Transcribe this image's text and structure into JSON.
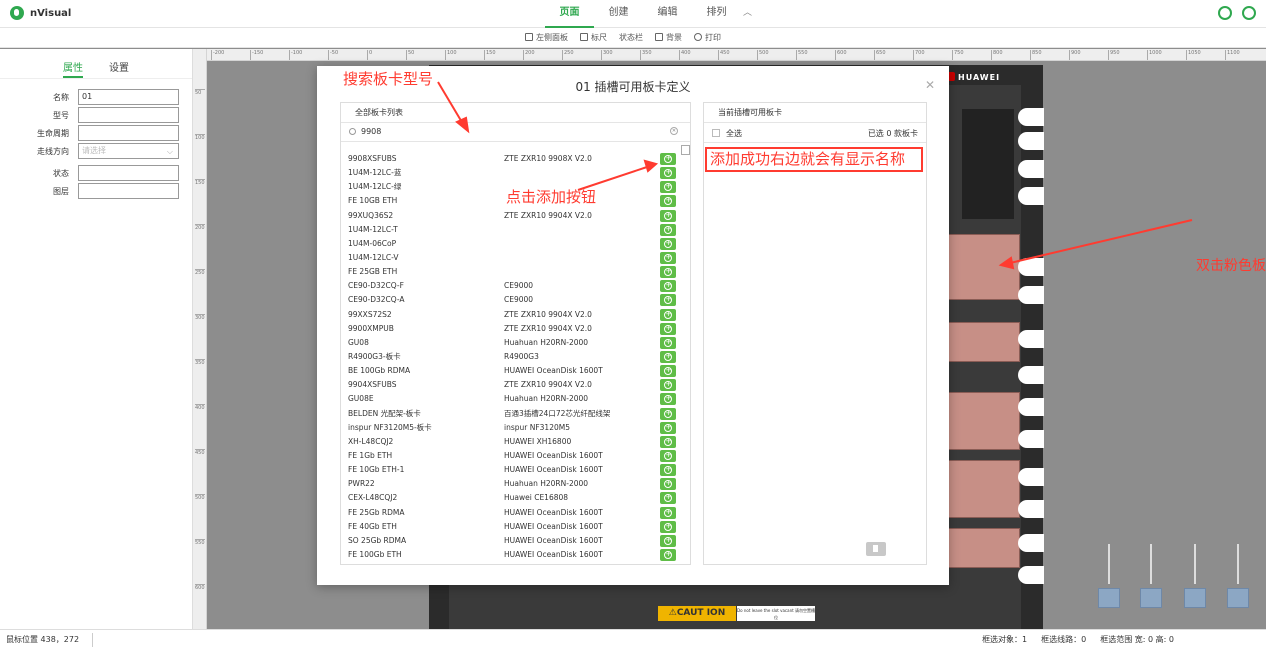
{
  "app": {
    "name": "nVisual"
  },
  "menu_tabs": [
    {
      "label": "页面",
      "active": true
    },
    {
      "label": "创建",
      "active": false
    },
    {
      "label": "编辑",
      "active": false
    },
    {
      "label": "排列",
      "active": false
    }
  ],
  "toolbar": {
    "items": [
      "左侧面板",
      "标尺",
      "状态栏",
      "背景",
      "打印"
    ]
  },
  "left_panel": {
    "tabs": [
      {
        "label": "属性",
        "active": true
      },
      {
        "label": "设置",
        "active": false
      }
    ],
    "fields": [
      {
        "label": "名称",
        "value": "01"
      },
      {
        "label": "型号",
        "value": ""
      },
      {
        "label": "生命周期",
        "value": ""
      },
      {
        "label": "走线方向",
        "value": "",
        "placeholder": "请选择"
      },
      {
        "label": "状态",
        "value": ""
      },
      {
        "label": "图层",
        "value": ""
      }
    ]
  },
  "ruler": {
    "top_ticks": [
      "-200",
      "-150",
      "-100",
      "-50",
      "0",
      "50",
      "100",
      "150",
      "200",
      "250",
      "300",
      "350",
      "400",
      "450",
      "500",
      "550",
      "600",
      "650",
      "700",
      "750",
      "800",
      "850",
      "900",
      "950",
      "1000",
      "1050",
      "1100"
    ],
    "left_ticks": [
      "50",
      "100",
      "150",
      "200",
      "250",
      "300",
      "350",
      "400",
      "450",
      "500",
      "550",
      "600"
    ]
  },
  "rack": {
    "brand": "HUAWEI",
    "caution": "⚠CAUT ION",
    "caution_note": "Do not leave the slot vacant 请勿空置槽位"
  },
  "modal": {
    "title": "01 插槽可用板卡定义",
    "left_header": "全部板卡列表",
    "search_value": "9908",
    "right_header": "当前插槽可用板卡",
    "select_all": "全选",
    "selected_count": "已选 0 款板卡",
    "cards": [
      {
        "model": "9908XSFUBS",
        "device": "ZTE ZXR10 9908X V2.0"
      },
      {
        "model": "1U4M-12LC-蓝",
        "device": ""
      },
      {
        "model": "1U4M-12LC-绿",
        "device": ""
      },
      {
        "model": "FE 10GB ETH",
        "device": ""
      },
      {
        "model": "99XUQ36S2",
        "device": "ZTE ZXR10 9904X V2.0"
      },
      {
        "model": "1U4M-12LC-T",
        "device": ""
      },
      {
        "model": "1U4M-06CoP",
        "device": ""
      },
      {
        "model": "1U4M-12LC-V",
        "device": ""
      },
      {
        "model": "FE 25GB ETH",
        "device": ""
      },
      {
        "model": "CE90-D32CQ-F",
        "device": "CE9000"
      },
      {
        "model": "CE90-D32CQ-A",
        "device": "CE9000"
      },
      {
        "model": "99XXS72S2",
        "device": "ZTE ZXR10 9904X V2.0"
      },
      {
        "model": "9900XMPUB",
        "device": "ZTE ZXR10 9904X V2.0"
      },
      {
        "model": "GU08",
        "device": "Huahuan H20RN-2000"
      },
      {
        "model": "R4900G3-板卡",
        "device": "R4900G3"
      },
      {
        "model": "BE 100Gb RDMA",
        "device": "HUAWEI OceanDisk 1600T"
      },
      {
        "model": "9904XSFUBS",
        "device": "ZTE ZXR10 9904X V2.0"
      },
      {
        "model": "GU08E",
        "device": "Huahuan H20RN-2000"
      },
      {
        "model": "BELDEN 光配架-板卡",
        "device": "百通3插槽24口72芯光纤配线架"
      },
      {
        "model": "inspur NF3120M5-板卡",
        "device": "inspur NF3120M5"
      },
      {
        "model": "XH-L48CQJ2",
        "device": "HUAWEI XH16800"
      },
      {
        "model": "FE 1Gb ETH",
        "device": "HUAWEI OceanDisk 1600T"
      },
      {
        "model": "FE 10Gb ETH-1",
        "device": "HUAWEI OceanDisk 1600T"
      },
      {
        "model": "PWR22",
        "device": "Huahuan H20RN-2000"
      },
      {
        "model": "CEX-L48CQJ2",
        "device": "Huawei CE16808"
      },
      {
        "model": "FE 25Gb RDMA",
        "device": "HUAWEI OceanDisk 1600T"
      },
      {
        "model": "FE 40Gb ETH",
        "device": "HUAWEI OceanDisk 1600T"
      },
      {
        "model": "SO 25Gb RDMA",
        "device": "HUAWEI OceanDisk 1600T"
      },
      {
        "model": "FE 100Gb ETH",
        "device": "HUAWEI OceanDisk 1600T"
      }
    ]
  },
  "annotations": {
    "search": "搜索板卡型号",
    "add": "点击添加按钮",
    "result": "添加成功右边就会有显示名称",
    "dblclick": "双击粉色板"
  },
  "status": {
    "mouse": "鼠标位置  438，272",
    "selected_objects": "框选对象：1",
    "selected_lines": "框选线路：0",
    "selected_range": "框选范围 宽: 0 高: 0"
  },
  "colors": {
    "accent": "#2fa84f",
    "annotation": "#ff3b30",
    "add_button": "#5fbd47",
    "card_pink": "#c78f86"
  }
}
